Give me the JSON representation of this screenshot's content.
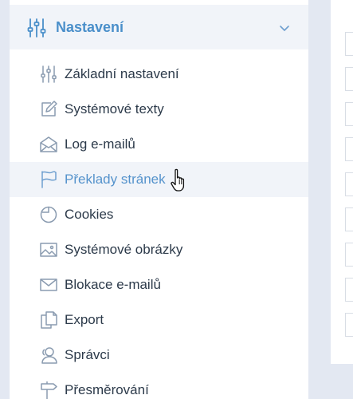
{
  "section": {
    "title": "Nastavení",
    "icon": "sliders-icon",
    "expanded": true,
    "chevron": "chevron-down-icon"
  },
  "menu": [
    {
      "label": "Základní nastavení",
      "icon": "sliders-icon"
    },
    {
      "label": "Systémové texty",
      "icon": "edit-icon"
    },
    {
      "label": "Log e-mailů",
      "icon": "open-envelope-icon"
    },
    {
      "label": "Překlady stránek",
      "icon": "flag-icon",
      "hovered": true
    },
    {
      "label": "Cookies",
      "icon": "cookie-icon"
    },
    {
      "label": "Systémové obrázky",
      "icon": "image-icon"
    },
    {
      "label": "Blokace e-mailů",
      "icon": "envelope-icon"
    },
    {
      "label": "Export",
      "icon": "copy-icon"
    },
    {
      "label": "Správci",
      "icon": "users-icon"
    },
    {
      "label": "Přesměrování",
      "icon": "signpost-icon"
    }
  ],
  "colors": {
    "accent": "#4a8fca",
    "icon": "#8a9bb0",
    "text": "#2c3a4a",
    "hover_bg": "#f1f4f9",
    "page_bg": "#e3e8f2"
  }
}
